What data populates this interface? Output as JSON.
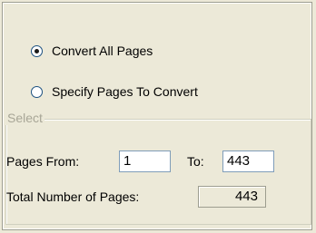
{
  "conversion_mode": {
    "options": [
      {
        "label": "Convert All Pages",
        "checked": true
      },
      {
        "label": "Specify Pages To Convert",
        "checked": false
      }
    ]
  },
  "select_group": {
    "legend": "Select",
    "pages_from_label": "Pages From:",
    "pages_from_value": "1",
    "to_label": "To:",
    "to_value": "443",
    "total_label": "Total Number of Pages:",
    "total_value": "443"
  }
}
